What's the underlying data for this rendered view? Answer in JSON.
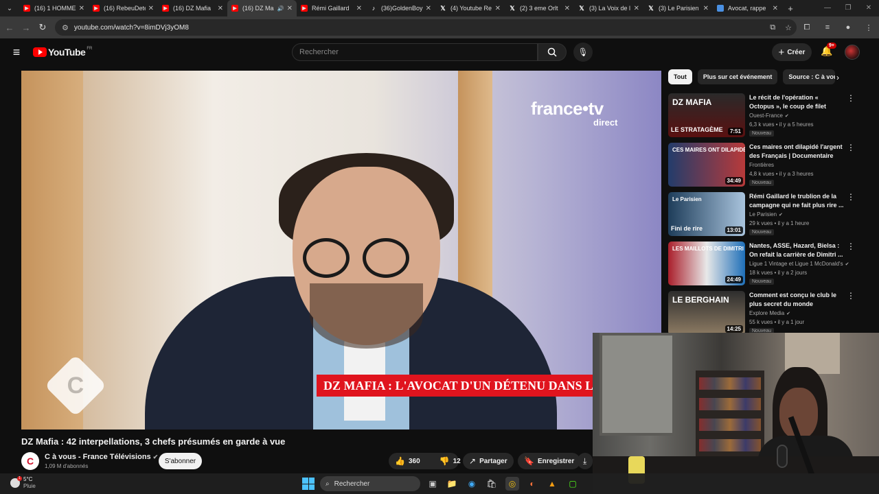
{
  "browser": {
    "tabs": [
      {
        "title": "(16) 1 HOMME",
        "favicon": "youtube-icon",
        "active": false
      },
      {
        "title": "(16) RebeuDeter",
        "favicon": "youtube-icon",
        "active": false
      },
      {
        "title": "(16) DZ Mafia",
        "favicon": "youtube-icon",
        "active": false
      },
      {
        "title": "(16) DZ Ma",
        "favicon": "youtube-icon",
        "active": true,
        "audio": true
      },
      {
        "title": "Rémi Gaillard",
        "favicon": "youtube-icon",
        "active": false
      },
      {
        "title": "(36)GoldenBoy",
        "favicon": "tiktok-icon",
        "active": false
      },
      {
        "title": "(4) Youtube Re",
        "favicon": "x-icon",
        "active": false
      },
      {
        "title": "(2) 3 eme Orlt",
        "favicon": "x-icon",
        "active": false
      },
      {
        "title": "(3) La Voix de l",
        "favicon": "x-icon",
        "active": false
      },
      {
        "title": "(3) Le Parisien",
        "favicon": "x-icon",
        "active": false
      },
      {
        "title": "Avocat, rappe",
        "favicon": "doc-icon",
        "active": false
      }
    ],
    "url": "youtube.com/watch?v=8imDVj3yOM8"
  },
  "youtube": {
    "logo_text": "YouTube",
    "country_code": "FR",
    "search_placeholder": "Rechercher",
    "create_label": "Créer",
    "notif_badge": "9+"
  },
  "video": {
    "network_logo": "france•tv",
    "network_sub": "direct",
    "banner_text": "DZ MAFIA : L'AVOCAT D'UN DÉTENU DANS LE VIS",
    "channel_logo_letter": "C",
    "title": "DZ Mafia : 42 interpellations, 3 chefs présumés en garde à vue",
    "channel_name": "C à vous - France Télévisions",
    "subscribers": "1,09 M d'abonnés",
    "subscribe_label": "S'abonner",
    "likes": "360",
    "dislikes": "12",
    "share_label": "Partager",
    "save_label": "Enregistrer"
  },
  "chips": [
    "Tout",
    "Plus sur cet événement",
    "Source : C à vous"
  ],
  "recommendations": [
    {
      "title": "Le récit de l'opération « Octopus », le coup de filet contre la DZ ...",
      "channel": "Ouest-France",
      "verified": true,
      "meta": "6,3 k vues • il y a 5 heures",
      "badge": "Nouveau",
      "duration": "7:51",
      "thumb_text": "DZ MAFIA",
      "thumb_text2": "LE STRATAGÈME"
    },
    {
      "title": "Ces maires ont dilapidé l'argent des Français | Documentaire",
      "channel": "Frontières",
      "verified": false,
      "meta": "4,8 k vues • il y a 3 heures",
      "badge": "Nouveau",
      "duration": "34:49",
      "thumb_text": "CES MAIRES ONT DILAPIDÉ VOTRE ARGENT",
      "thumb_text2": ""
    },
    {
      "title": "Rémi Gaillard le trublion de la campagne qui ne fait plus rire ...",
      "channel": "Le Parisien",
      "verified": true,
      "meta": "29 k vues • il y a 1 heure",
      "badge": "Nouveau",
      "duration": "13:01",
      "thumb_text": "Le Parisien",
      "thumb_text2": "Fini de rire"
    },
    {
      "title": "Nantes, ASSE, Hazard, Bielsa : On refait la carrière de Dimitri ...",
      "channel": "Ligue 1 Vintage et Ligue 1 McDonald's",
      "verified": true,
      "meta": "18 k vues • il y a 2 jours",
      "badge": "Nouveau",
      "duration": "24:49",
      "thumb_text": "LES MAILLOTS DE DIMITRI PAYET",
      "thumb_text2": ""
    },
    {
      "title": "Comment est conçu le club le plus secret du monde",
      "channel": "Explore Media",
      "verified": true,
      "meta": "55 k vues • il y a 1 jour",
      "badge": "Nouveau",
      "duration": "14:25",
      "thumb_text": "LE BERGHAIN",
      "thumb_text2": ""
    }
  ],
  "taskbar": {
    "temperature": "5°C",
    "weather": "Pluie",
    "weather_badge": "1",
    "search_label": "Rechercher"
  }
}
